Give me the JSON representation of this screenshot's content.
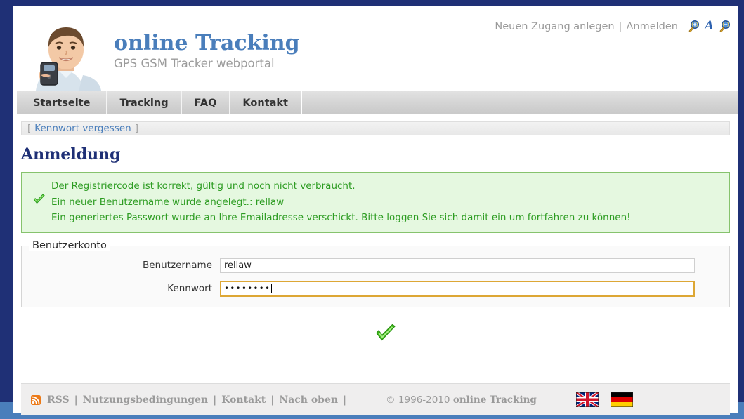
{
  "window": {
    "frame_color": "#1f3076",
    "frame_accent_color": "#4a7ebb"
  },
  "utility": {
    "register_link": "Neuen Zugang anlegen",
    "separator": "|",
    "login_link": "Anmelden",
    "icons": [
      {
        "name": "zoom-in-icon",
        "label": "A+"
      },
      {
        "name": "font-size-icon",
        "label": "A"
      },
      {
        "name": "zoom-out-icon",
        "label": "A-"
      }
    ]
  },
  "brand": {
    "title": "online Tracking",
    "tagline": "GPS GSM Tracker webportal",
    "title_color": "#4a7ebb",
    "photo_alt": "boy-with-gps-tracker-photo"
  },
  "nav": {
    "tabs": [
      {
        "label": "Startseite",
        "active": true
      },
      {
        "label": "Tracking",
        "active": false
      },
      {
        "label": "FAQ",
        "active": false
      },
      {
        "label": "Kontakt",
        "active": false
      }
    ]
  },
  "breadcrumb": {
    "open_bracket": "[",
    "link": "Kennwort vergessen",
    "close_bracket": "]"
  },
  "page": {
    "title": "Anmeldung"
  },
  "messages": {
    "status": "success",
    "accent_color": "#2d9c22",
    "background_color": "#e5f8e0",
    "border_color": "#86c36d",
    "icon": "green-check-icon",
    "lines": [
      "Der Registriercode ist korrekt, gültig und noch nicht verbraucht.",
      "Ein neuer Benutzername wurde angelegt.: rellaw",
      "Ein generiertes Passwort wurde an Ihre Emailadresse verschickt. Bitte loggen Sie sich damit ein um fortfahren zu können!"
    ]
  },
  "form": {
    "legend": "Benutzerkonto",
    "fields": [
      {
        "label": "Benutzername",
        "name": "username-input",
        "value": "rellaw",
        "placeholder": "",
        "focused": false
      },
      {
        "label": "Kennwort",
        "name": "password-input",
        "value": "••••••••",
        "placeholder": "",
        "focused": true,
        "focus_border_color": "#dda735"
      }
    ],
    "submit": {
      "name": "submit-button",
      "icon": "green-check-icon",
      "label": ""
    }
  },
  "footer": {
    "rss_label": "RSS",
    "links": [
      "Nutzungsbedingungen",
      "Kontakt",
      "Nach oben"
    ],
    "separator": "|",
    "copyright_prefix": "© 1996-2010 ",
    "copyright_brand": "online Tracking",
    "flags": [
      {
        "name": "flag-uk",
        "label": "English"
      },
      {
        "name": "flag-de",
        "label": "Deutsch"
      }
    ]
  }
}
